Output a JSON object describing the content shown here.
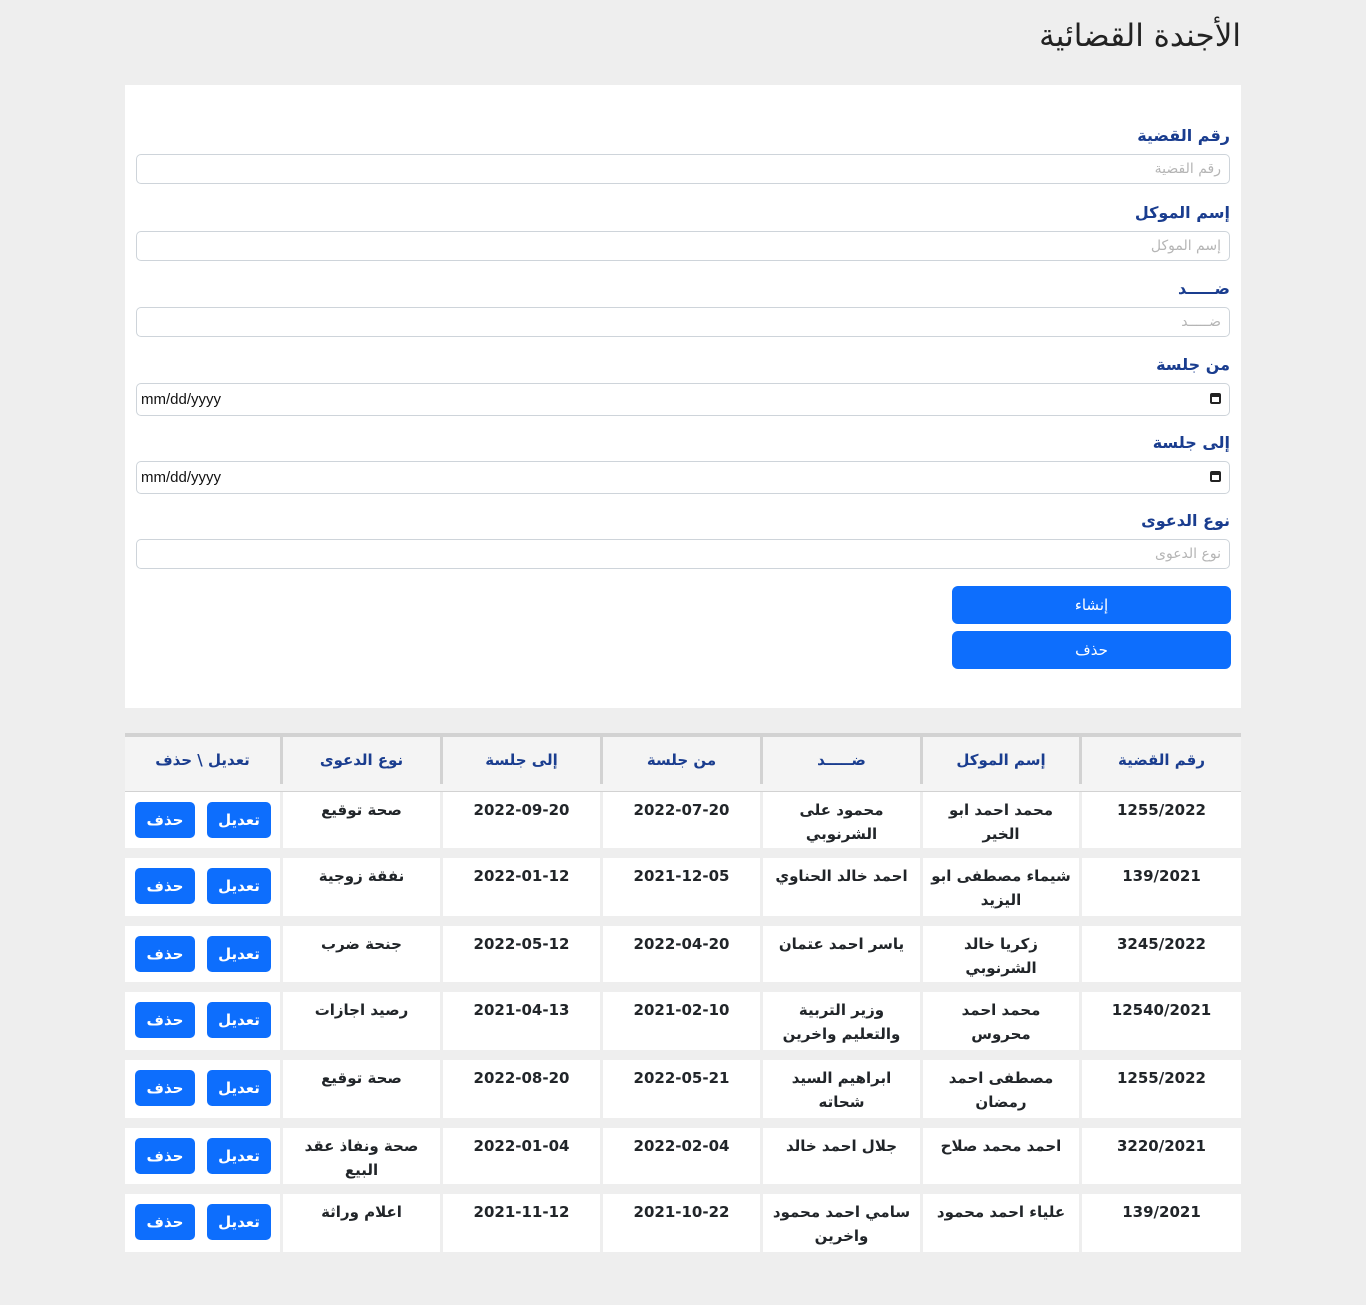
{
  "page": {
    "title": "الأجندة القضائية"
  },
  "form": {
    "case_no": {
      "label": "رقم القضية",
      "placeholder": "رقم القضية"
    },
    "client": {
      "label": "إسم الموكل",
      "placeholder": "إسم الموكل"
    },
    "against": {
      "label": "ضـــــد",
      "placeholder": "ضـــــد"
    },
    "from_session": {
      "label": "من جلسة",
      "value": "mm/dd/yyyy"
    },
    "to_session": {
      "label": "إلى جلسة",
      "value": "mm/dd/yyyy"
    },
    "case_type": {
      "label": "نوع الدعوى",
      "placeholder": "نوع الدعوى"
    },
    "create_label": "إنشاء",
    "delete_label": "حذف"
  },
  "table": {
    "headers": [
      "رقم القضية",
      "إسم الموكل",
      "ضـــــد",
      "من جلسة",
      "إلى جلسة",
      "نوع الدعوى",
      "تعديل \\ حذف"
    ],
    "edit_label": "تعديل",
    "delete_label": "حذف",
    "rows": [
      [
        "1255/2022",
        "محمد احمد ابو الخير",
        "محمود على الشرنوبي",
        "2022-07-20",
        "2022-09-20",
        "صحة توقيع"
      ],
      [
        "139/2021",
        "شيماء مصطفى ابو اليزيد",
        "احمد خالد الحناوي",
        "2021-12-05",
        "2022-01-12",
        "نفقة زوجية"
      ],
      [
        "3245/2022",
        "زكريا خالد الشرنوبي",
        "ياسر احمد عتمان",
        "2022-04-20",
        "2022-05-12",
        "جنحة ضرب"
      ],
      [
        "12540/2021",
        "محمد احمد محروس",
        "وزير التربية والتعليم واخرين",
        "2021-02-10",
        "2021-04-13",
        "رصيد اجازات"
      ],
      [
        "1255/2022",
        "مصطفى احمد رمضان",
        "ابراهيم السيد شحاته",
        "2022-05-21",
        "2022-08-20",
        "صحة توقيع"
      ],
      [
        "3220/2021",
        "احمد محمد صلاح",
        "جلال احمد خالد",
        "2022-02-04",
        "2022-01-04",
        "صحة ونفاذ عقد البيع"
      ],
      [
        "139/2021",
        "علياء احمد محمود",
        "سامي احمد محمود واخرين",
        "2021-10-22",
        "2021-11-12",
        "اعلام وراثة"
      ]
    ]
  },
  "colors": {
    "primary": "#0d6efd",
    "label": "#1a3d8f",
    "background": "#eeeeee"
  }
}
